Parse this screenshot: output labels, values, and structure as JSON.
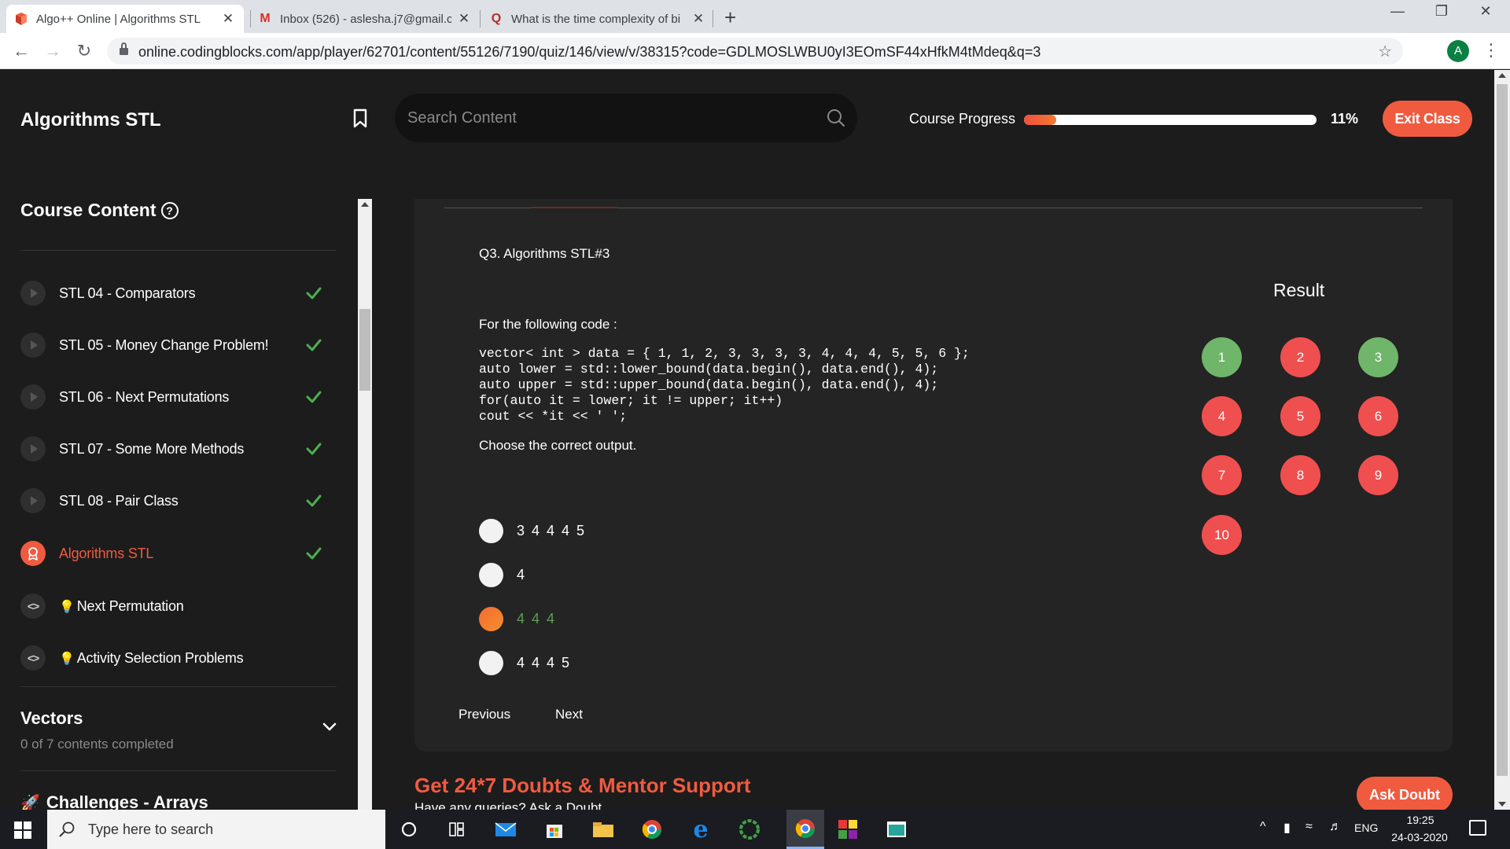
{
  "browser": {
    "tabs": [
      {
        "title": "Algo++ Online | Algorithms STL",
        "active": true
      },
      {
        "title": "Inbox (526) - aslesha.j7@gmail.co",
        "active": false
      },
      {
        "title": "What is the time complexity of bi",
        "active": false
      }
    ],
    "url": "online.codingblocks.com/app/player/62701/content/55126/7190/quiz/146/view/v/38315?code=GDLMOSLWBU0yI3EOmSF44xHfkM4tMdeq&q=3",
    "profile_initial": "A",
    "close_glyph": "✕",
    "new_tab_glyph": "+"
  },
  "header": {
    "title": "Algorithms STL",
    "search_placeholder": "Search Content",
    "progress_label": "Course Progress",
    "progress_value": 11,
    "progress_text": "11%",
    "exit_label": "Exit Class"
  },
  "sidebar": {
    "title": "Course Content",
    "help_glyph": "?",
    "items": [
      {
        "label": "STL 04 - Comparators",
        "type": "video",
        "done": true
      },
      {
        "label": "STL 05 - Money Change Problem!",
        "type": "video",
        "done": true
      },
      {
        "label": "STL 06 - Next Permutations",
        "type": "video",
        "done": true
      },
      {
        "label": "STL 07 - Some More Methods",
        "type": "video",
        "done": true
      },
      {
        "label": "STL 08 - Pair Class",
        "type": "video",
        "done": true
      },
      {
        "label": "Algorithms STL",
        "type": "quiz",
        "done": true,
        "active": true
      },
      {
        "label": "Next Permutation",
        "type": "code",
        "done": false
      },
      {
        "label": "Activity Selection Problems",
        "type": "code",
        "done": false
      }
    ],
    "sections": [
      {
        "title": "Vectors",
        "subtitle": "0 of 7 contents completed"
      },
      {
        "title": "Challenges - Arrays"
      }
    ]
  },
  "quiz": {
    "question_title": "Q3. Algorithms STL#3",
    "intro": "For the following code :",
    "code": "vector< int > data = { 1, 1, 2, 3, 3, 3, 3, 4, 4, 4, 5, 5, 6 };\nauto lower = std::lower_bound(data.begin(), data.end(), 4);\nauto upper = std::upper_bound(data.begin(), data.end(), 4);\nfor(auto it = lower; it != upper; it++)\ncout << *it << ' ';",
    "prompt": "Choose the correct output.",
    "options": [
      {
        "text": "3 4 4 4 5",
        "selected": false
      },
      {
        "text": "4",
        "selected": false
      },
      {
        "text": "4 4 4",
        "selected": true
      },
      {
        "text": "4 4 4 5",
        "selected": false
      }
    ],
    "prev_label": "Previous",
    "next_label": "Next",
    "result_title": "Result",
    "results": [
      {
        "n": "1",
        "status": "correct"
      },
      {
        "n": "2",
        "status": "wrong"
      },
      {
        "n": "3",
        "status": "correct"
      },
      {
        "n": "4",
        "status": "wrong"
      },
      {
        "n": "5",
        "status": "wrong"
      },
      {
        "n": "6",
        "status": "wrong"
      },
      {
        "n": "7",
        "status": "wrong"
      },
      {
        "n": "8",
        "status": "wrong"
      },
      {
        "n": "9",
        "status": "wrong"
      },
      {
        "n": "10",
        "status": "wrong"
      }
    ]
  },
  "support": {
    "title": "Get 24*7 Doubts & Mentor Support",
    "subtitle": "Have any queries? Ask a Doubt",
    "ask_label": "Ask Doubt"
  },
  "taskbar": {
    "search_text": "Type here to search",
    "language": "ENG",
    "time": "19:25",
    "date": "24-03-2020"
  },
  "colors": {
    "accent": "#f05b40",
    "correct": "#6fb56a",
    "wrong": "#f04f4f",
    "check": "#4caf50"
  }
}
